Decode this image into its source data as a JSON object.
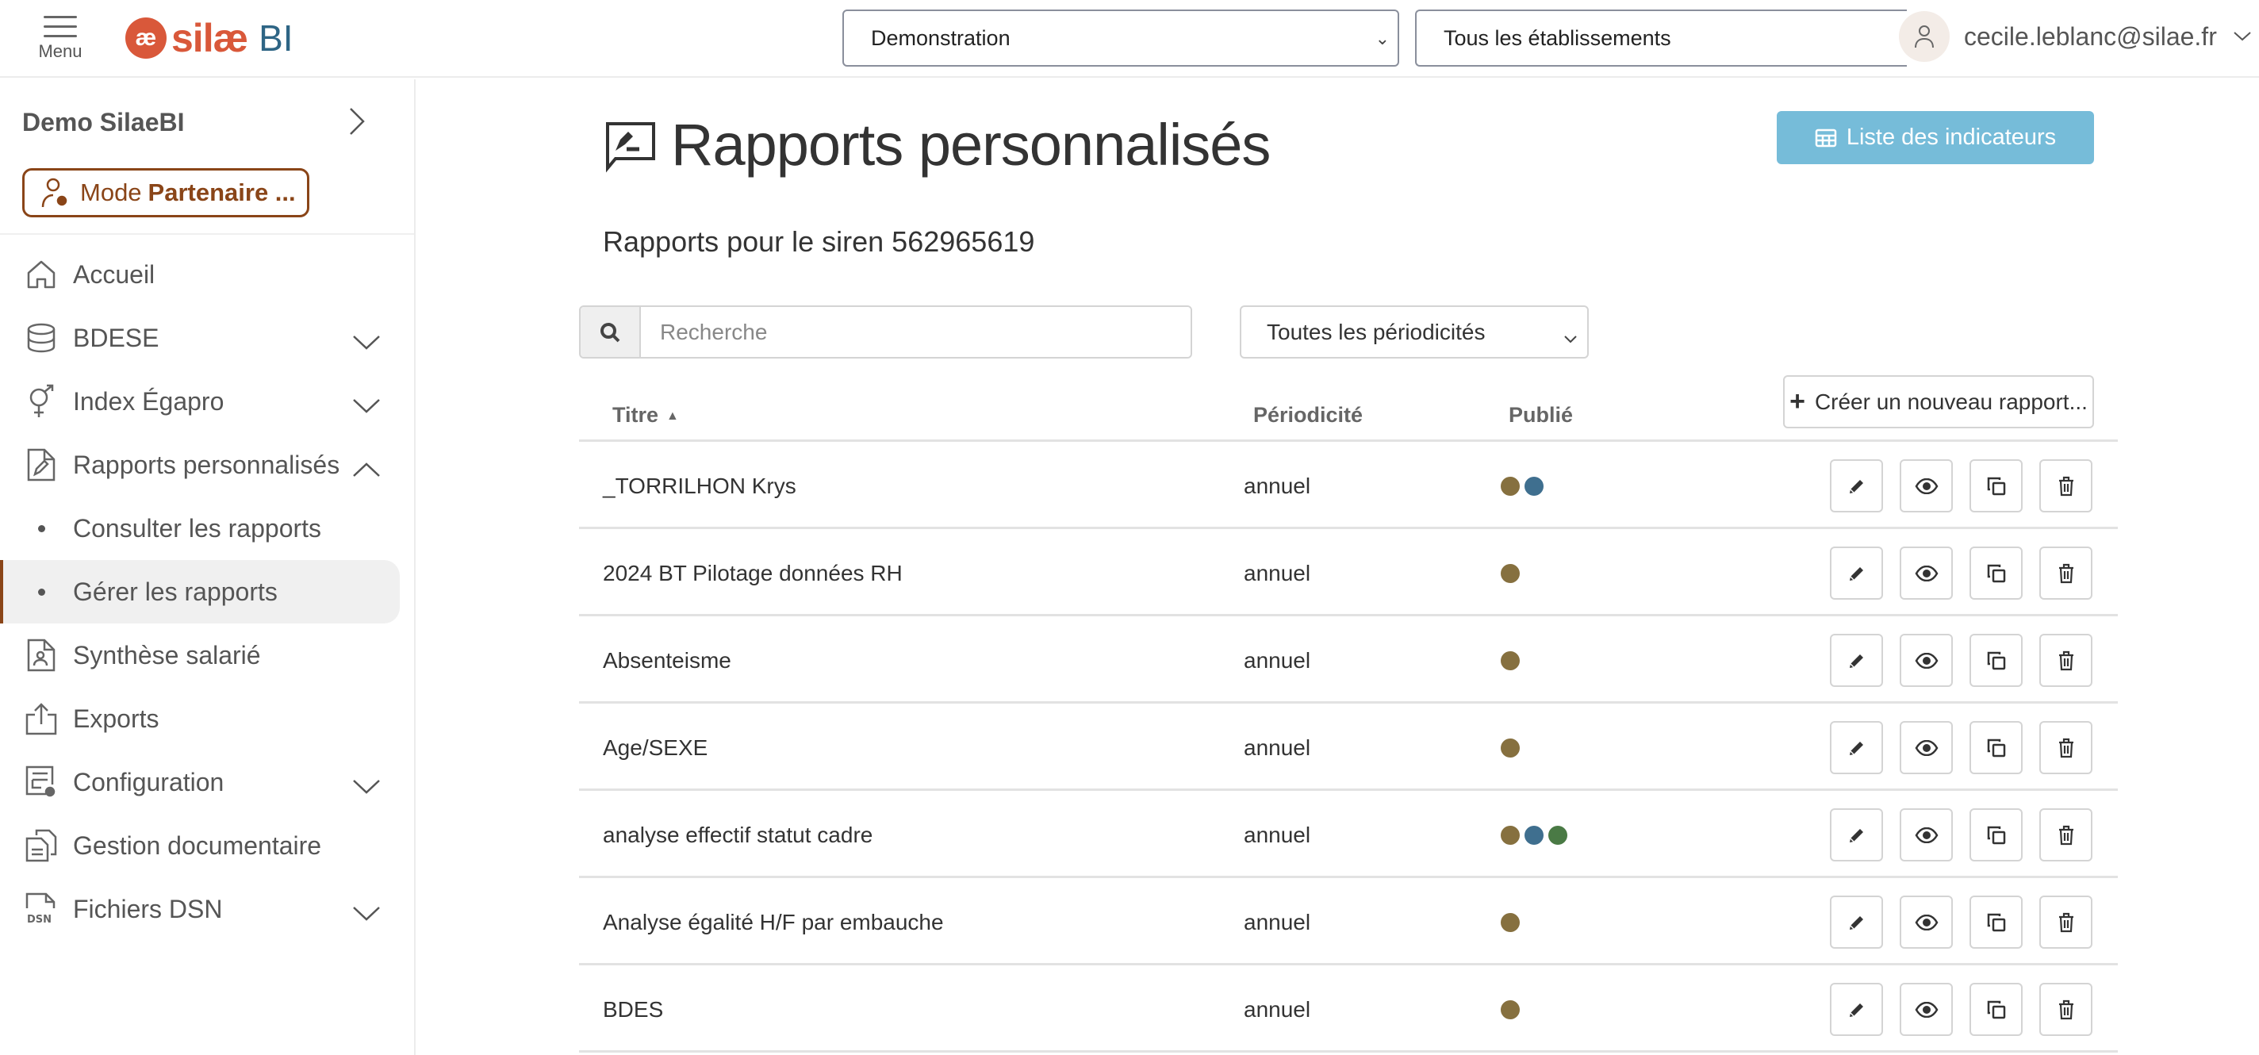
{
  "topbar": {
    "menu_label": "Menu",
    "logo_mark": "æ",
    "logo_word": "silæ",
    "logo_suffix": "BI",
    "company_select": "Demonstration",
    "establishment_select": "Tous les établissements",
    "user_email": "cecile.leblanc@silae.fr"
  },
  "sidebar": {
    "org_name": "Demo SilaeBI",
    "partner_mode_prefix": "Mode",
    "partner_mode_bold": "Partenaire ...",
    "items": [
      {
        "label": "Accueil",
        "icon": "home-icon"
      },
      {
        "label": "BDESE",
        "icon": "database-icon",
        "expandable": true
      },
      {
        "label": "Index Égapro",
        "icon": "gender-icon",
        "expandable": true
      },
      {
        "label": "Rapports personnalisés",
        "icon": "report-edit-icon",
        "expandable": true,
        "expanded": true,
        "children": [
          {
            "label": "Consulter les rapports"
          },
          {
            "label": "Gérer les rapports",
            "active": true
          }
        ]
      },
      {
        "label": "Synthèse salarié",
        "icon": "employee-file-icon"
      },
      {
        "label": "Exports",
        "icon": "export-icon"
      },
      {
        "label": "Configuration",
        "icon": "config-icon",
        "expandable": true
      },
      {
        "label": "Gestion documentaire",
        "icon": "documents-icon"
      },
      {
        "label": "Fichiers DSN",
        "icon": "dsn-file-icon",
        "expandable": true
      }
    ]
  },
  "main": {
    "title": "Rapports personnalisés",
    "subtitle": "Rapports pour le siren 562965619",
    "indicators_button": "Liste des indicateurs",
    "search_placeholder": "Recherche",
    "search_value": "",
    "periodicity_select": "Toutes les périodicités",
    "create_button": "Créer un nouveau rapport...",
    "columns": {
      "title": "Titre",
      "periodicity": "Périodicité",
      "published": "Publié"
    },
    "publish_colors": {
      "brown": "#86703f",
      "blue": "#3f6f8f",
      "green": "#4a7a45"
    },
    "rows": [
      {
        "title": "_TORRILHON Krys",
        "periodicity": "annuel",
        "published": [
          "brown",
          "blue"
        ]
      },
      {
        "title": "2024 BT Pilotage données RH",
        "periodicity": "annuel",
        "published": [
          "brown"
        ]
      },
      {
        "title": "Absenteisme",
        "periodicity": "annuel",
        "published": [
          "brown"
        ]
      },
      {
        "title": "Age/SEXE",
        "periodicity": "annuel",
        "published": [
          "brown"
        ]
      },
      {
        "title": "analyse effectif statut cadre",
        "periodicity": "annuel",
        "published": [
          "brown",
          "blue",
          "green"
        ]
      },
      {
        "title": "Analyse égalité H/F par embauche",
        "periodicity": "annuel",
        "published": [
          "brown"
        ]
      },
      {
        "title": "BDES",
        "periodicity": "annuel",
        "published": [
          "brown"
        ]
      }
    ]
  },
  "colors": {
    "brand_orange": "#d9583a",
    "brand_blue": "#2e6585",
    "partner_brown": "#8a4518",
    "indicators_button_bg": "#76bcd9"
  }
}
